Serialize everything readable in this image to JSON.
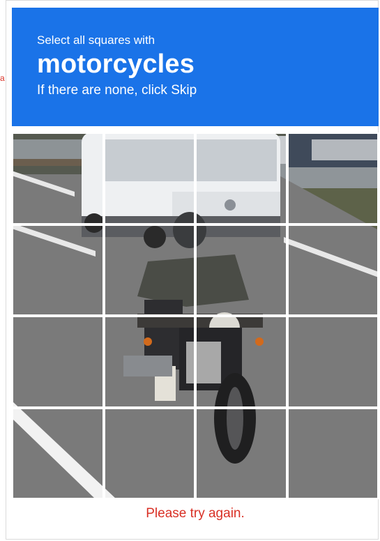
{
  "side_text": "a",
  "header": {
    "instruction": "Select all squares with",
    "keyword": "motorcycles",
    "subtext": "If there are none, click Skip"
  },
  "grid": {
    "rows": 4,
    "columns": 4,
    "tiles": [
      "tile-1",
      "tile-2",
      "tile-3",
      "tile-4",
      "tile-5",
      "tile-6",
      "tile-7",
      "tile-8",
      "tile-9",
      "tile-10",
      "tile-11",
      "tile-12",
      "tile-13",
      "tile-14",
      "tile-15",
      "tile-16"
    ]
  },
  "status": {
    "error": "Please try again."
  },
  "colors": {
    "header_bg": "#1a73e8",
    "error": "#d93025"
  }
}
